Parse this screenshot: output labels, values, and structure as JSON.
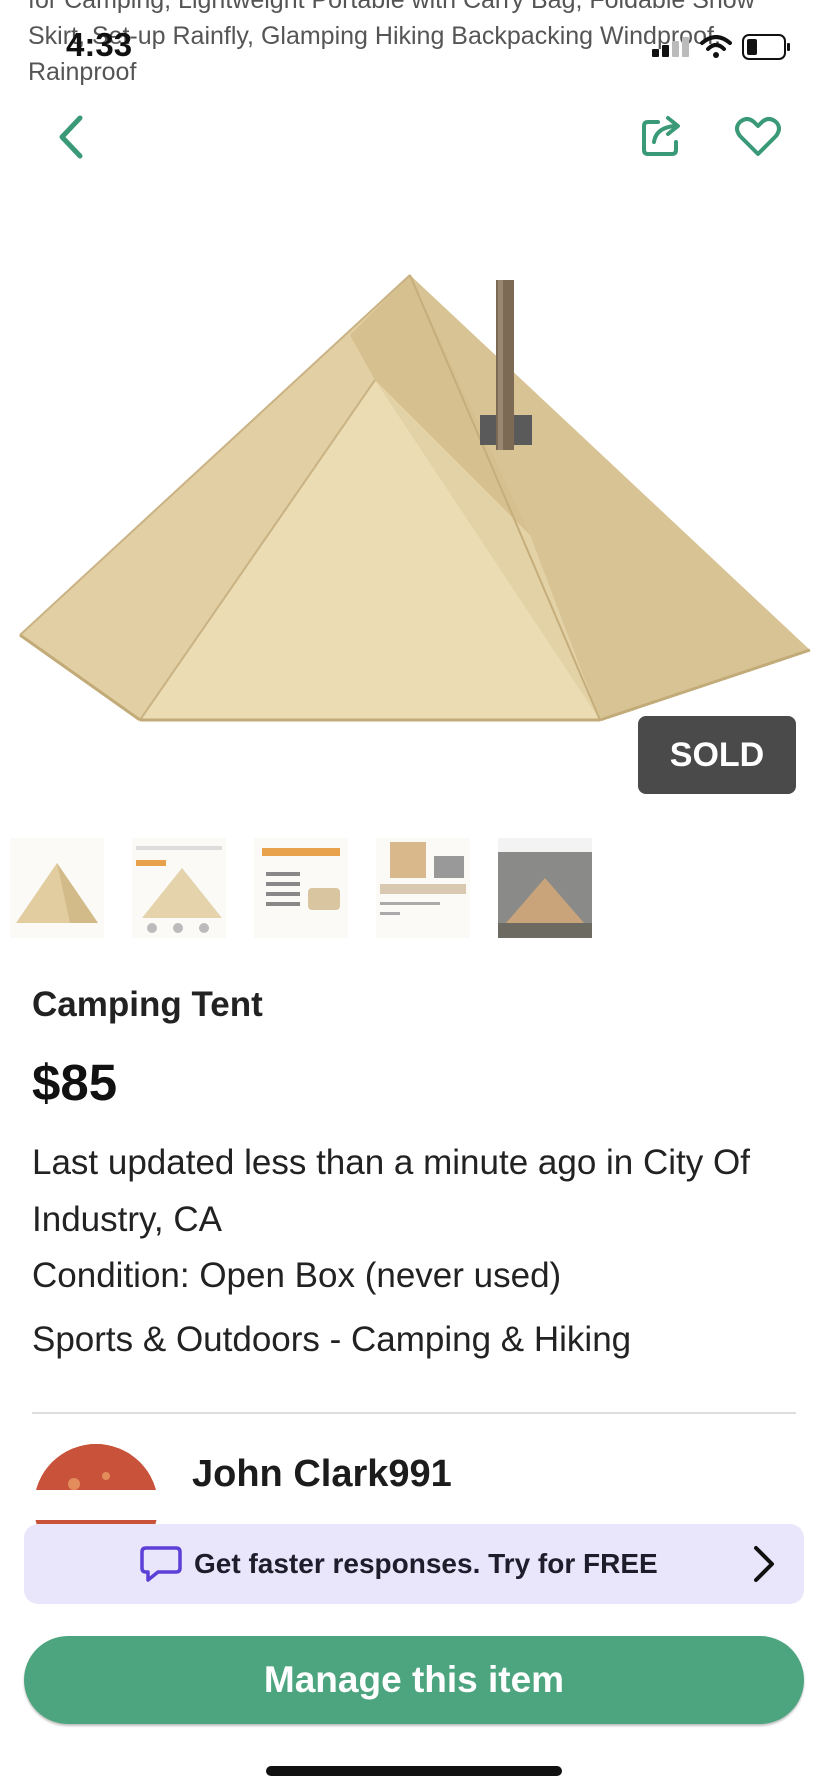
{
  "listing_title_overflow": "for Camping, Lightweight Portable with Carry Bag, Foldable Snow Skirt, Set-up Rainfly, Glamping Hiking Backpacking Windproof, Rainproof",
  "status_bar": {
    "time": "4:33"
  },
  "nav": {
    "back_icon": "chevron-left-icon",
    "share_icon": "share-icon",
    "favorite_icon": "heart-icon"
  },
  "hero": {
    "badge": "SOLD"
  },
  "thumbnails": [
    {
      "name": "tent-photo-1"
    },
    {
      "name": "tent-photo-2"
    },
    {
      "name": "tent-photo-3"
    },
    {
      "name": "tent-photo-4"
    },
    {
      "name": "tent-photo-5"
    }
  ],
  "item": {
    "title": "Camping Tent",
    "price": "$85",
    "updated": "Last updated less than a minute ago in City Of Industry, CA",
    "condition": "Condition: Open Box (never used)",
    "category": "Sports & Outdoors - Camping & Hiking"
  },
  "seller": {
    "name": "John Clark991"
  },
  "promo": {
    "text": "Get faster responses. Try for FREE"
  },
  "actions": {
    "manage_label": "Manage this item"
  },
  "colors": {
    "accent": "#4ca57e",
    "promo_bg": "#e9e6fb",
    "badge_bg": "#4a4a4a"
  }
}
